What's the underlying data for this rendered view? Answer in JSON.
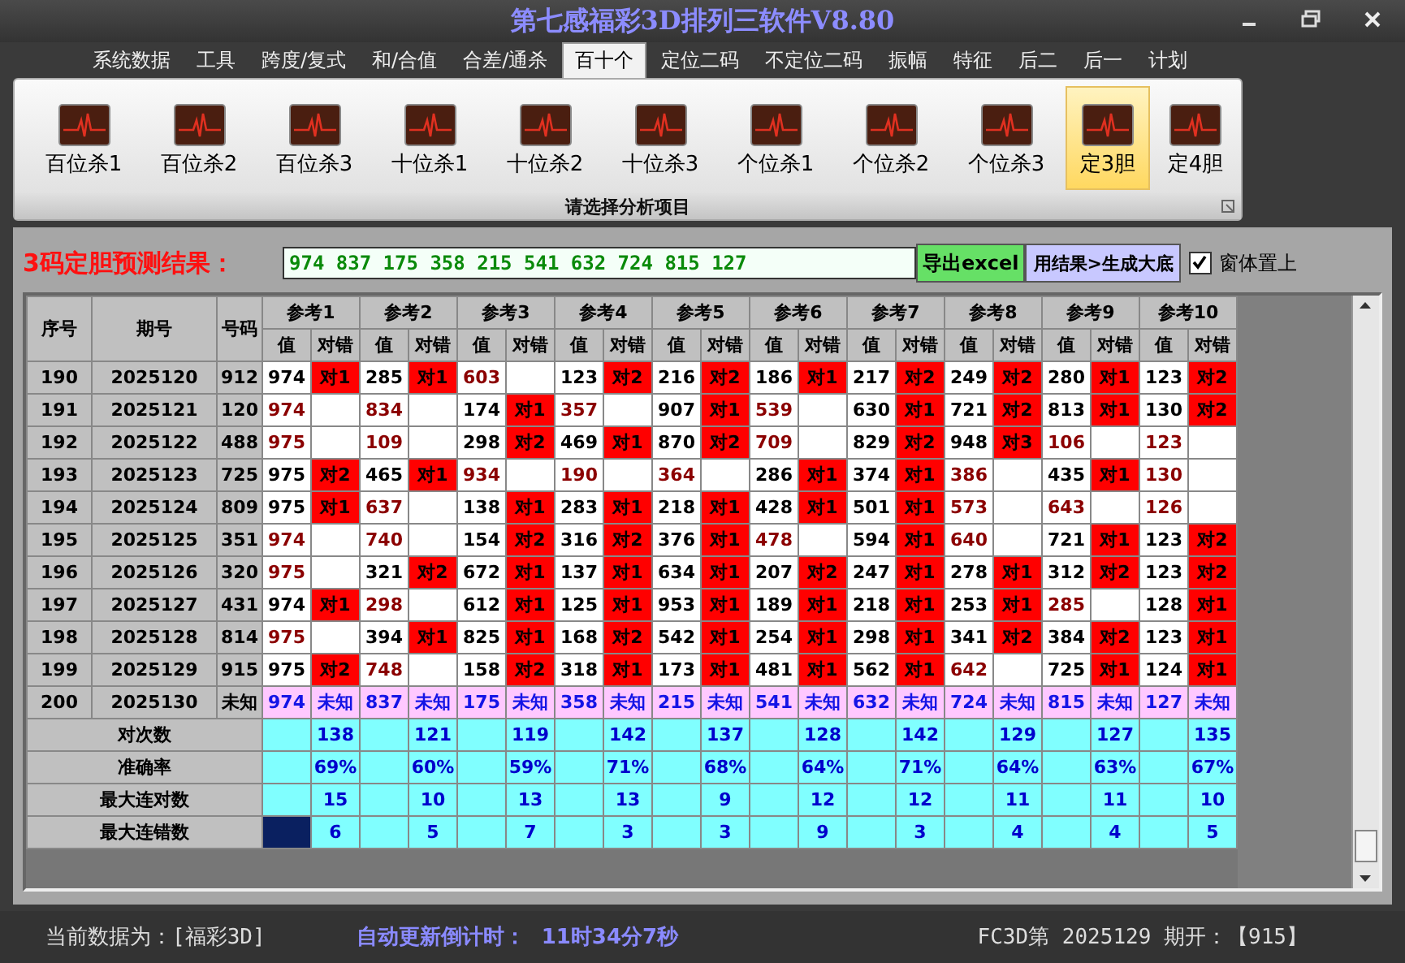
{
  "window": {
    "title": "第七感福彩3D排列三软件V8.80"
  },
  "tabs": [
    {
      "label": "系统数据",
      "selected": false
    },
    {
      "label": "工具",
      "selected": false
    },
    {
      "label": "跨度/复式",
      "selected": false
    },
    {
      "label": "和/合值",
      "selected": false
    },
    {
      "label": "合差/通杀",
      "selected": false
    },
    {
      "label": "百十个",
      "selected": true
    },
    {
      "label": "定位二码",
      "selected": false
    },
    {
      "label": "不定位二码",
      "selected": false
    },
    {
      "label": "振幅",
      "selected": false
    },
    {
      "label": "特征",
      "selected": false
    },
    {
      "label": "后二",
      "selected": false
    },
    {
      "label": "后一",
      "selected": false
    },
    {
      "label": "计划",
      "selected": false
    }
  ],
  "ribbon": {
    "group_label": "请选择分析项目",
    "buttons": [
      {
        "label": "百位杀1",
        "selected": false
      },
      {
        "label": "百位杀2",
        "selected": false
      },
      {
        "label": "百位杀3",
        "selected": false
      },
      {
        "label": "十位杀1",
        "selected": false
      },
      {
        "label": "十位杀2",
        "selected": false
      },
      {
        "label": "十位杀3",
        "selected": false
      },
      {
        "label": "个位杀1",
        "selected": false
      },
      {
        "label": "个位杀2",
        "selected": false
      },
      {
        "label": "个位杀3",
        "selected": false
      },
      {
        "label": "定3胆",
        "selected": true
      },
      {
        "label": "定4胆",
        "selected": false
      }
    ]
  },
  "result": {
    "label": "3码定胆预测结果：",
    "value": "974 837 175 358 215 541 632 724 815 127",
    "export_button": "导出excel",
    "generate_button": "用结果>生成大底",
    "topmost": {
      "label": "窗体置上",
      "checked": true
    }
  },
  "table": {
    "columns": [
      "序号",
      "期号",
      "号码"
    ],
    "refs": [
      {
        "title": "参考1",
        "sub": [
          "值",
          "对错"
        ]
      },
      {
        "title": "参考2",
        "sub": [
          "值",
          "对错"
        ]
      },
      {
        "title": "参考3",
        "sub": [
          "值",
          "对错"
        ]
      },
      {
        "title": "参考4",
        "sub": [
          "值",
          "对错"
        ]
      },
      {
        "title": "参考5",
        "sub": [
          "值",
          "对错"
        ]
      },
      {
        "title": "参考6",
        "sub": [
          "值",
          "对错"
        ]
      },
      {
        "title": "参考7",
        "sub": [
          "值",
          "对错"
        ]
      },
      {
        "title": "参考8",
        "sub": [
          "值",
          "对错"
        ]
      },
      {
        "title": "参考9",
        "sub": [
          "值",
          "对错"
        ]
      },
      {
        "title": "参考10",
        "sub": [
          "值",
          "对错"
        ]
      }
    ],
    "rows": [
      {
        "kind": "history",
        "seq": "190",
        "period": "2025120",
        "number": "912",
        "cells": [
          {
            "value": "974",
            "hit": true,
            "result": "对1"
          },
          {
            "value": "285",
            "hit": true,
            "result": "对1"
          },
          {
            "value": "603",
            "hit": false
          },
          {
            "value": "123",
            "hit": true,
            "result": "对2"
          },
          {
            "value": "216",
            "hit": true,
            "result": "对2"
          },
          {
            "value": "186",
            "hit": true,
            "result": "对1"
          },
          {
            "value": "217",
            "hit": true,
            "result": "对2"
          },
          {
            "value": "249",
            "hit": true,
            "result": "对2"
          },
          {
            "value": "280",
            "hit": true,
            "result": "对1"
          },
          {
            "value": "123",
            "hit": true,
            "result": "对2"
          }
        ]
      },
      {
        "kind": "history",
        "seq": "191",
        "period": "2025121",
        "number": "120",
        "cells": [
          {
            "value": "974",
            "hit": false
          },
          {
            "value": "834",
            "hit": false
          },
          {
            "value": "174",
            "hit": true,
            "result": "对1"
          },
          {
            "value": "357",
            "hit": false
          },
          {
            "value": "907",
            "hit": true,
            "result": "对1"
          },
          {
            "value": "539",
            "hit": false
          },
          {
            "value": "630",
            "hit": true,
            "result": "对1"
          },
          {
            "value": "721",
            "hit": true,
            "result": "对2"
          },
          {
            "value": "813",
            "hit": true,
            "result": "对1"
          },
          {
            "value": "130",
            "hit": true,
            "result": "对2"
          }
        ]
      },
      {
        "kind": "history",
        "seq": "192",
        "period": "2025122",
        "number": "488",
        "cells": [
          {
            "value": "975",
            "hit": false
          },
          {
            "value": "109",
            "hit": false
          },
          {
            "value": "298",
            "hit": true,
            "result": "对2"
          },
          {
            "value": "469",
            "hit": true,
            "result": "对1"
          },
          {
            "value": "870",
            "hit": true,
            "result": "对2"
          },
          {
            "value": "709",
            "hit": false
          },
          {
            "value": "829",
            "hit": true,
            "result": "对2"
          },
          {
            "value": "948",
            "hit": true,
            "result": "对3"
          },
          {
            "value": "106",
            "hit": false
          },
          {
            "value": "123",
            "hit": false
          }
        ]
      },
      {
        "kind": "history",
        "seq": "193",
        "period": "2025123",
        "number": "725",
        "cells": [
          {
            "value": "975",
            "hit": true,
            "result": "对2"
          },
          {
            "value": "465",
            "hit": true,
            "result": "对1"
          },
          {
            "value": "934",
            "hit": false
          },
          {
            "value": "190",
            "hit": false
          },
          {
            "value": "364",
            "hit": false
          },
          {
            "value": "286",
            "hit": true,
            "result": "对1"
          },
          {
            "value": "374",
            "hit": true,
            "result": "对1"
          },
          {
            "value": "386",
            "hit": false
          },
          {
            "value": "435",
            "hit": true,
            "result": "对1"
          },
          {
            "value": "130",
            "hit": false
          }
        ]
      },
      {
        "kind": "history",
        "seq": "194",
        "period": "2025124",
        "number": "809",
        "cells": [
          {
            "value": "975",
            "hit": true,
            "result": "对1"
          },
          {
            "value": "637",
            "hit": false
          },
          {
            "value": "138",
            "hit": true,
            "result": "对1"
          },
          {
            "value": "283",
            "hit": true,
            "result": "对1"
          },
          {
            "value": "218",
            "hit": true,
            "result": "对1"
          },
          {
            "value": "428",
            "hit": true,
            "result": "对1"
          },
          {
            "value": "501",
            "hit": true,
            "result": "对1"
          },
          {
            "value": "573",
            "hit": false
          },
          {
            "value": "643",
            "hit": false
          },
          {
            "value": "126",
            "hit": false
          }
        ]
      },
      {
        "kind": "history",
        "seq": "195",
        "period": "2025125",
        "number": "351",
        "cells": [
          {
            "value": "974",
            "hit": false
          },
          {
            "value": "740",
            "hit": false
          },
          {
            "value": "154",
            "hit": true,
            "result": "对2"
          },
          {
            "value": "316",
            "hit": true,
            "result": "对2"
          },
          {
            "value": "376",
            "hit": true,
            "result": "对1"
          },
          {
            "value": "478",
            "hit": false
          },
          {
            "value": "594",
            "hit": true,
            "result": "对1"
          },
          {
            "value": "640",
            "hit": false
          },
          {
            "value": "721",
            "hit": true,
            "result": "对1"
          },
          {
            "value": "123",
            "hit": true,
            "result": "对2"
          }
        ]
      },
      {
        "kind": "history",
        "seq": "196",
        "period": "2025126",
        "number": "320",
        "cells": [
          {
            "value": "975",
            "hit": false
          },
          {
            "value": "321",
            "hit": true,
            "result": "对2"
          },
          {
            "value": "672",
            "hit": true,
            "result": "对1"
          },
          {
            "value": "137",
            "hit": true,
            "result": "对1"
          },
          {
            "value": "634",
            "hit": true,
            "result": "对1"
          },
          {
            "value": "207",
            "hit": true,
            "result": "对2"
          },
          {
            "value": "247",
            "hit": true,
            "result": "对1"
          },
          {
            "value": "278",
            "hit": true,
            "result": "对1"
          },
          {
            "value": "312",
            "hit": true,
            "result": "对2"
          },
          {
            "value": "123",
            "hit": true,
            "result": "对2"
          }
        ]
      },
      {
        "kind": "history",
        "seq": "197",
        "period": "2025127",
        "number": "431",
        "cells": [
          {
            "value": "974",
            "hit": true,
            "result": "对1"
          },
          {
            "value": "298",
            "hit": false
          },
          {
            "value": "612",
            "hit": true,
            "result": "对1"
          },
          {
            "value": "125",
            "hit": true,
            "result": "对1"
          },
          {
            "value": "953",
            "hit": true,
            "result": "对1"
          },
          {
            "value": "189",
            "hit": true,
            "result": "对1"
          },
          {
            "value": "218",
            "hit": true,
            "result": "对1"
          },
          {
            "value": "253",
            "hit": true,
            "result": "对1"
          },
          {
            "value": "285",
            "hit": false
          },
          {
            "value": "128",
            "hit": true,
            "result": "对1"
          }
        ]
      },
      {
        "kind": "history",
        "seq": "198",
        "period": "2025128",
        "number": "814",
        "cells": [
          {
            "value": "975",
            "hit": false
          },
          {
            "value": "394",
            "hit": true,
            "result": "对1"
          },
          {
            "value": "825",
            "hit": true,
            "result": "对1"
          },
          {
            "value": "168",
            "hit": true,
            "result": "对2"
          },
          {
            "value": "542",
            "hit": true,
            "result": "对1"
          },
          {
            "value": "254",
            "hit": true,
            "result": "对1"
          },
          {
            "value": "298",
            "hit": true,
            "result": "对1"
          },
          {
            "value": "341",
            "hit": true,
            "result": "对2"
          },
          {
            "value": "384",
            "hit": true,
            "result": "对2"
          },
          {
            "value": "123",
            "hit": true,
            "result": "对1"
          }
        ]
      },
      {
        "kind": "history",
        "seq": "199",
        "period": "2025129",
        "number": "915",
        "cells": [
          {
            "value": "975",
            "hit": true,
            "result": "对2"
          },
          {
            "value": "748",
            "hit": false
          },
          {
            "value": "158",
            "hit": true,
            "result": "对2"
          },
          {
            "value": "318",
            "hit": true,
            "result": "对1"
          },
          {
            "value": "173",
            "hit": true,
            "result": "对1"
          },
          {
            "value": "481",
            "hit": true,
            "result": "对1"
          },
          {
            "value": "562",
            "hit": true,
            "result": "对1"
          },
          {
            "value": "642",
            "hit": false
          },
          {
            "value": "725",
            "hit": true,
            "result": "对1"
          },
          {
            "value": "124",
            "hit": true,
            "result": "对1"
          }
        ]
      },
      {
        "kind": "forecast",
        "seq": "200",
        "period": "2025130",
        "number": "未知",
        "cells": [
          {
            "value": "974",
            "result": "未知"
          },
          {
            "value": "837",
            "result": "未知"
          },
          {
            "value": "175",
            "result": "未知"
          },
          {
            "value": "358",
            "result": "未知"
          },
          {
            "value": "215",
            "result": "未知"
          },
          {
            "value": "541",
            "result": "未知"
          },
          {
            "value": "632",
            "result": "未知"
          },
          {
            "value": "724",
            "result": "未知"
          },
          {
            "value": "815",
            "result": "未知"
          },
          {
            "value": "127",
            "result": "未知"
          }
        ]
      }
    ],
    "stats": [
      {
        "label": "对次数",
        "cells": [
          {
            "value": "138",
            "selected": false
          },
          {
            "value": "121",
            "selected": false
          },
          {
            "value": "119",
            "selected": false
          },
          {
            "value": "142",
            "selected": false
          },
          {
            "value": "137",
            "selected": false
          },
          {
            "value": "128",
            "selected": false
          },
          {
            "value": "142",
            "selected": false
          },
          {
            "value": "129",
            "selected": false
          },
          {
            "value": "127",
            "selected": false
          },
          {
            "value": "135",
            "selected": false
          }
        ]
      },
      {
        "label": "准确率",
        "cells": [
          {
            "value": "69%",
            "selected": false
          },
          {
            "value": "60%",
            "selected": false
          },
          {
            "value": "59%",
            "selected": false
          },
          {
            "value": "71%",
            "selected": false
          },
          {
            "value": "68%",
            "selected": false
          },
          {
            "value": "64%",
            "selected": false
          },
          {
            "value": "71%",
            "selected": false
          },
          {
            "value": "64%",
            "selected": false
          },
          {
            "value": "63%",
            "selected": false
          },
          {
            "value": "67%",
            "selected": false
          }
        ]
      },
      {
        "label": "最大连对数",
        "cells": [
          {
            "value": "15",
            "selected": false
          },
          {
            "value": "10",
            "selected": false
          },
          {
            "value": "13",
            "selected": false
          },
          {
            "value": "13",
            "selected": false
          },
          {
            "value": "9",
            "selected": false
          },
          {
            "value": "12",
            "selected": false
          },
          {
            "value": "12",
            "selected": false
          },
          {
            "value": "11",
            "selected": false
          },
          {
            "value": "11",
            "selected": false
          },
          {
            "value": "10",
            "selected": false
          }
        ]
      },
      {
        "label": "最大连错数",
        "cells": [
          {
            "value": "6",
            "selected": true
          },
          {
            "value": "5",
            "selected": false
          },
          {
            "value": "7",
            "selected": false
          },
          {
            "value": "3",
            "selected": false
          },
          {
            "value": "3",
            "selected": false
          },
          {
            "value": "9",
            "selected": false
          },
          {
            "value": "3",
            "selected": false
          },
          {
            "value": "4",
            "selected": false
          },
          {
            "value": "4",
            "selected": false
          },
          {
            "value": "5",
            "selected": false
          }
        ]
      }
    ]
  },
  "status_bar": {
    "data_source": "当前数据为：[福彩3D]",
    "countdown_label": "自动更新倒计时：",
    "countdown": "11时34分7秒",
    "latest": "FC3D第 2025129 期开：【915】"
  }
}
